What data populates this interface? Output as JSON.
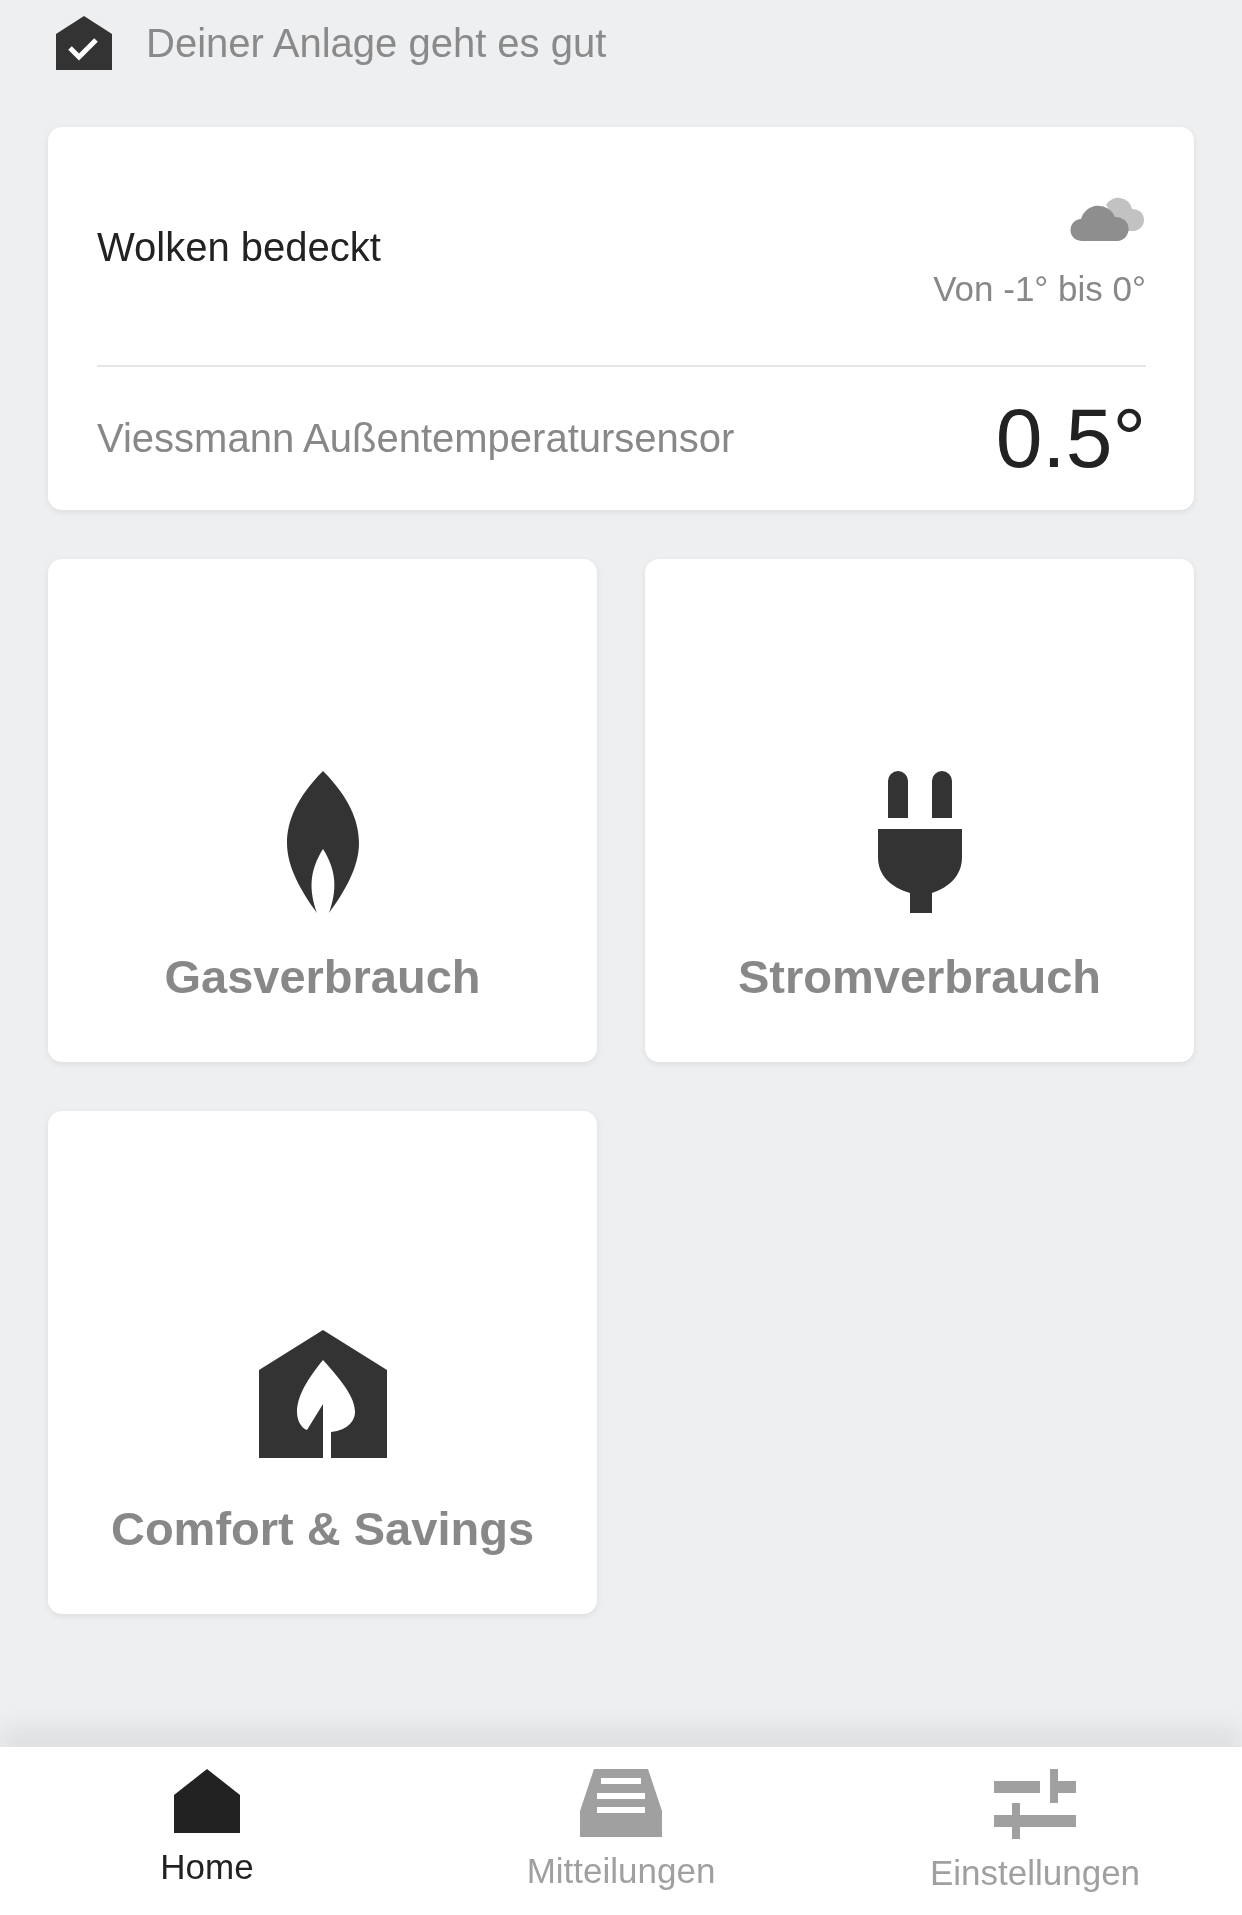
{
  "status": {
    "text": "Deiner Anlage geht es gut"
  },
  "weather": {
    "condition": "Wolken bedeckt",
    "range": "Von -1° bis 0°",
    "sensor": "Viessmann Außentemperatursensor",
    "temperature": "0.5°"
  },
  "tiles": [
    {
      "kind": "gas",
      "label": "Gasverbrauch"
    },
    {
      "kind": "power",
      "label": "Stromverbrauch"
    },
    {
      "kind": "comfort",
      "label": "Comfort & Savings"
    }
  ],
  "nav": [
    {
      "kind": "home",
      "label": "Home",
      "selected": true
    },
    {
      "kind": "messages",
      "label": "Mitteilungen",
      "selected": false
    },
    {
      "kind": "settings",
      "label": "Einstellungen",
      "selected": false
    }
  ]
}
